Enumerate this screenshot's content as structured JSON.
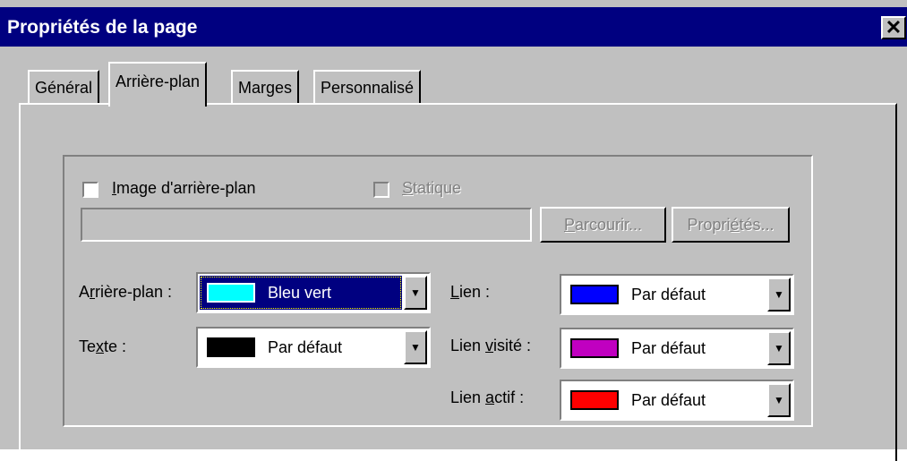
{
  "window": {
    "title": "Propriétés de la page",
    "close_glyph": "✕"
  },
  "tabs": [
    {
      "label": "Général"
    },
    {
      "label": "Arrière-plan"
    },
    {
      "label": "Marges"
    },
    {
      "label": "Personnalisé"
    }
  ],
  "background_image": {
    "checkbox_label_pre": "",
    "checkbox_label_u": "I",
    "checkbox_label_post": "mage d'arrière-plan",
    "checked": false,
    "static_label_u": "S",
    "static_label_post": "tatique",
    "path_value": "",
    "browse_pre": "",
    "browse_u": "P",
    "browse_post": "arcourir...",
    "props_pre": "Propri",
    "props_u": "é",
    "props_post": "tés..."
  },
  "colors": {
    "background": {
      "label_pre": "A",
      "label_u": "r",
      "label_post": "rière-plan :",
      "value": "Bleu vert",
      "swatch": "#00ffff"
    },
    "text": {
      "label_pre": "Te",
      "label_u": "x",
      "label_post": "te :",
      "value": "Par défaut",
      "swatch": "#000000"
    },
    "link": {
      "label_pre": "",
      "label_u": "L",
      "label_post": "ien :",
      "value": "Par défaut",
      "swatch": "#0000ff"
    },
    "visited": {
      "label_pre": "Lien ",
      "label_u": "v",
      "label_post": "isité :",
      "value": "Par défaut",
      "swatch": "#c000c0"
    },
    "active": {
      "label_pre": "Lien ",
      "label_u": "a",
      "label_post": "ctif :",
      "value": "Par défaut",
      "swatch": "#ff0000"
    }
  },
  "icons": {
    "dropdown": "▼"
  },
  "theme": {
    "titlebar": "#000080",
    "face": "#c0c0c0"
  }
}
